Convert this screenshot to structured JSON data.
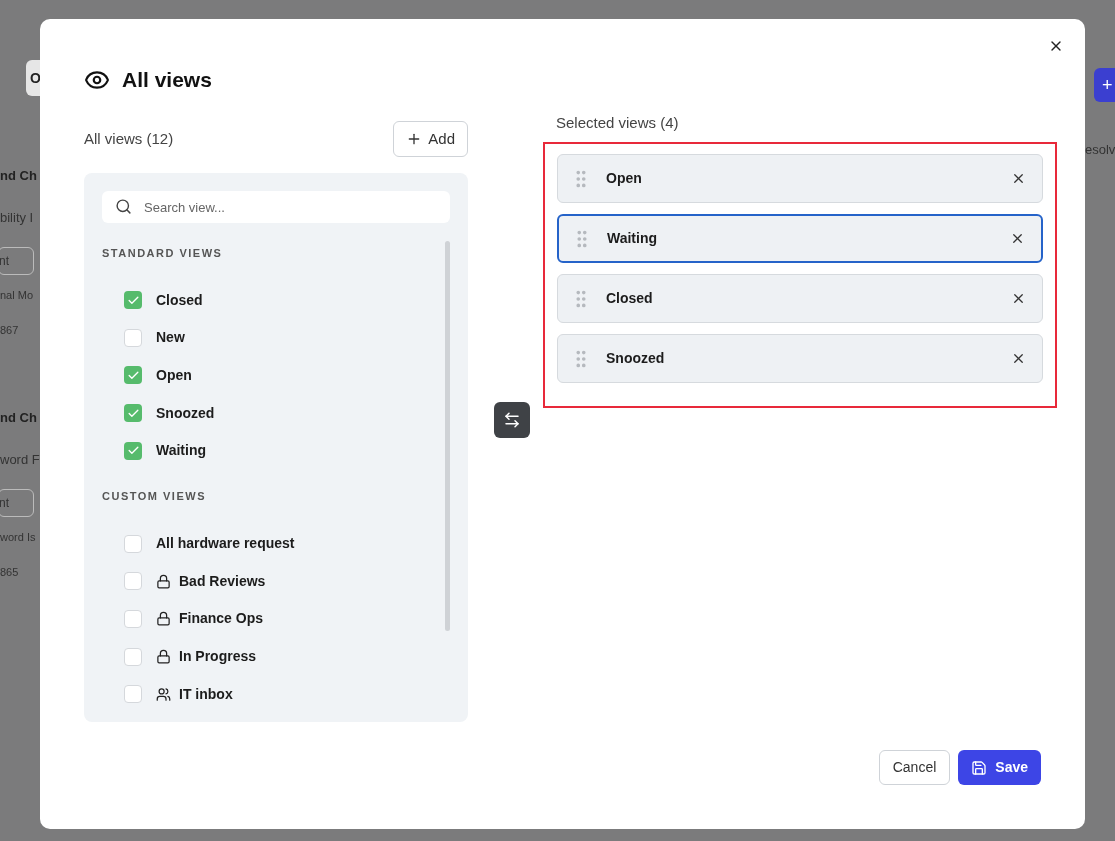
{
  "background": {
    "left_fragments": [
      {
        "kind": "tab",
        "text": "O"
      },
      {
        "kind": "title",
        "text": "nd Ch"
      },
      {
        "kind": "line",
        "text": "bility I"
      },
      {
        "kind": "chip",
        "text": "nt"
      },
      {
        "kind": "tag",
        "text": "nal Mo"
      },
      {
        "kind": "meta",
        "text": "867"
      },
      {
        "kind": "title",
        "text": "nd Ch"
      },
      {
        "kind": "line",
        "text": "word F"
      },
      {
        "kind": "chip",
        "text": "nt"
      },
      {
        "kind": "tag",
        "text": "word Is"
      },
      {
        "kind": "meta",
        "text": "865"
      }
    ],
    "right_fragments": [
      {
        "kind": "plus",
        "text": "+"
      },
      {
        "kind": "line",
        "text": "esolv"
      }
    ]
  },
  "modal": {
    "title": "All views",
    "left": {
      "heading": "All views (12)",
      "add_button": "Add",
      "search": {
        "placeholder": "Search view..."
      },
      "sections": [
        {
          "title": "STANDARD VIEWS",
          "items": [
            {
              "label": "Closed",
              "checked": true,
              "kind": "plain"
            },
            {
              "label": "New",
              "checked": false,
              "kind": "plain"
            },
            {
              "label": "Open",
              "checked": true,
              "kind": "plain"
            },
            {
              "label": "Snoozed",
              "checked": true,
              "kind": "plain"
            },
            {
              "label": "Waiting",
              "checked": true,
              "kind": "plain"
            }
          ]
        },
        {
          "title": "CUSTOM VIEWS",
          "items": [
            {
              "label": "All hardware request",
              "checked": false,
              "kind": "plain"
            },
            {
              "label": "Bad Reviews",
              "checked": false,
              "kind": "private"
            },
            {
              "label": "Finance Ops",
              "checked": false,
              "kind": "private"
            },
            {
              "label": "In Progress",
              "checked": false,
              "kind": "private"
            },
            {
              "label": "IT inbox",
              "checked": false,
              "kind": "team"
            }
          ]
        }
      ]
    },
    "right": {
      "heading": "Selected views (4)",
      "highlighted": true,
      "items": [
        {
          "label": "Open",
          "selected": false
        },
        {
          "label": "Waiting",
          "selected": true
        },
        {
          "label": "Closed",
          "selected": false
        },
        {
          "label": "Snoozed",
          "selected": false
        }
      ]
    },
    "buttons": {
      "cancel": "Cancel",
      "save": "Save"
    }
  }
}
